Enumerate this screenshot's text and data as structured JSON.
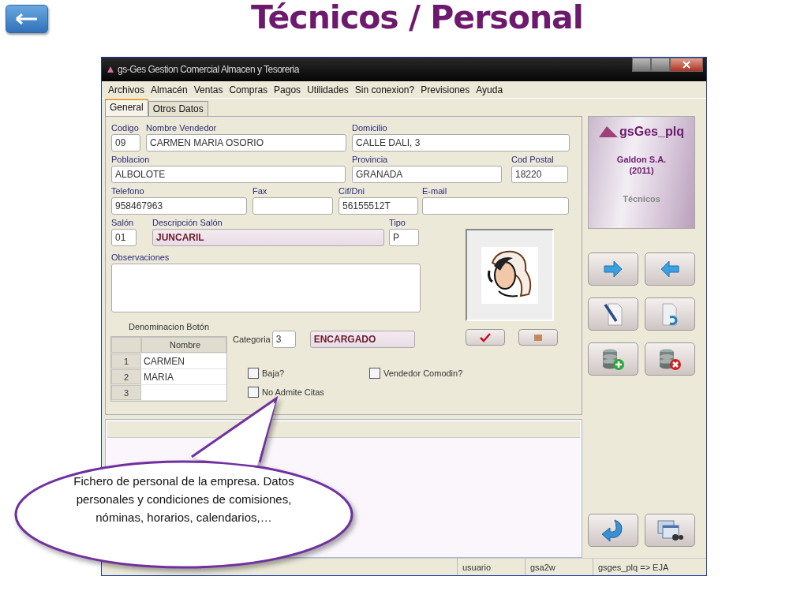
{
  "slide": {
    "title": "Técnicos / Personal"
  },
  "window": {
    "title": "gs-Ges Gestion Comercial Almacen y Tesoreria",
    "menu": [
      "Archivos",
      "Almacén",
      "Ventas",
      "Compras",
      "Pagos",
      "Utilidades",
      "Sin conexion?",
      "Previsiones",
      "Ayuda"
    ],
    "tabs": [
      {
        "label": "General",
        "selected": true
      },
      {
        "label": "Otros Datos",
        "selected": false
      }
    ],
    "field_rows": [
      [
        {
          "label": "Codigo",
          "value": "09",
          "kind": "text"
        },
        {
          "label": "Nombre Vendedor",
          "value": "CARMEN MARIA OSORIO",
          "kind": "text"
        },
        {
          "label": "Domicilio",
          "value": "CALLE DALI, 3",
          "kind": "text"
        }
      ],
      [
        {
          "label": "Poblacion",
          "value": "ALBOLOTE",
          "kind": "text"
        },
        {
          "label": "Provincia",
          "value": "GRANADA",
          "kind": "text"
        },
        {
          "label": "Cod Postal",
          "value": "18220",
          "kind": "text"
        }
      ],
      [
        {
          "label": "Telefono",
          "value": "958467963",
          "kind": "text"
        },
        {
          "label": "Fax",
          "kind": "text"
        },
        {
          "label": "Cif/Dni",
          "value": "56155512T",
          "kind": "text"
        },
        {
          "label": "E-mail",
          "kind": "text"
        }
      ],
      [
        {
          "label": "Salón",
          "value": "01",
          "kind": "text"
        },
        {
          "label": "Descripción Salón",
          "value": "JUNCARIL",
          "kind": "lookup"
        },
        {
          "label": "Tipo",
          "value": "P",
          "kind": "text"
        }
      ]
    ],
    "observaciones": {
      "label": "Observaciones"
    },
    "button_names": {
      "title": "Denominacion Botón",
      "columns": [
        "Nombre"
      ],
      "rows": [
        {
          "number": "1",
          "name": "CARMEN"
        },
        {
          "number": "2",
          "name": "MARIA"
        },
        {
          "number": "3"
        }
      ]
    },
    "categoria": {
      "label": "Categoria",
      "value": "3",
      "description": "ENCARGADO"
    },
    "checkboxes": [
      {
        "label": "Baja?",
        "checked": false
      },
      {
        "label": "Vendedor Comodin?",
        "checked": false
      },
      {
        "label": "No Admite Citas",
        "checked": false
      }
    ],
    "logo": {
      "name": "gsGes_plq",
      "company": "Galdon S.A.",
      "year": "(2011)",
      "module": "Técnicos"
    },
    "status_bar": [
      "usuario",
      "gsa2w",
      "gsges_plq => EJA"
    ]
  },
  "callout": {
    "text": "Fichero de personal de la empresa. Datos personales y condiciones de comisiones, nóminas, horarios, calendarios,…"
  }
}
